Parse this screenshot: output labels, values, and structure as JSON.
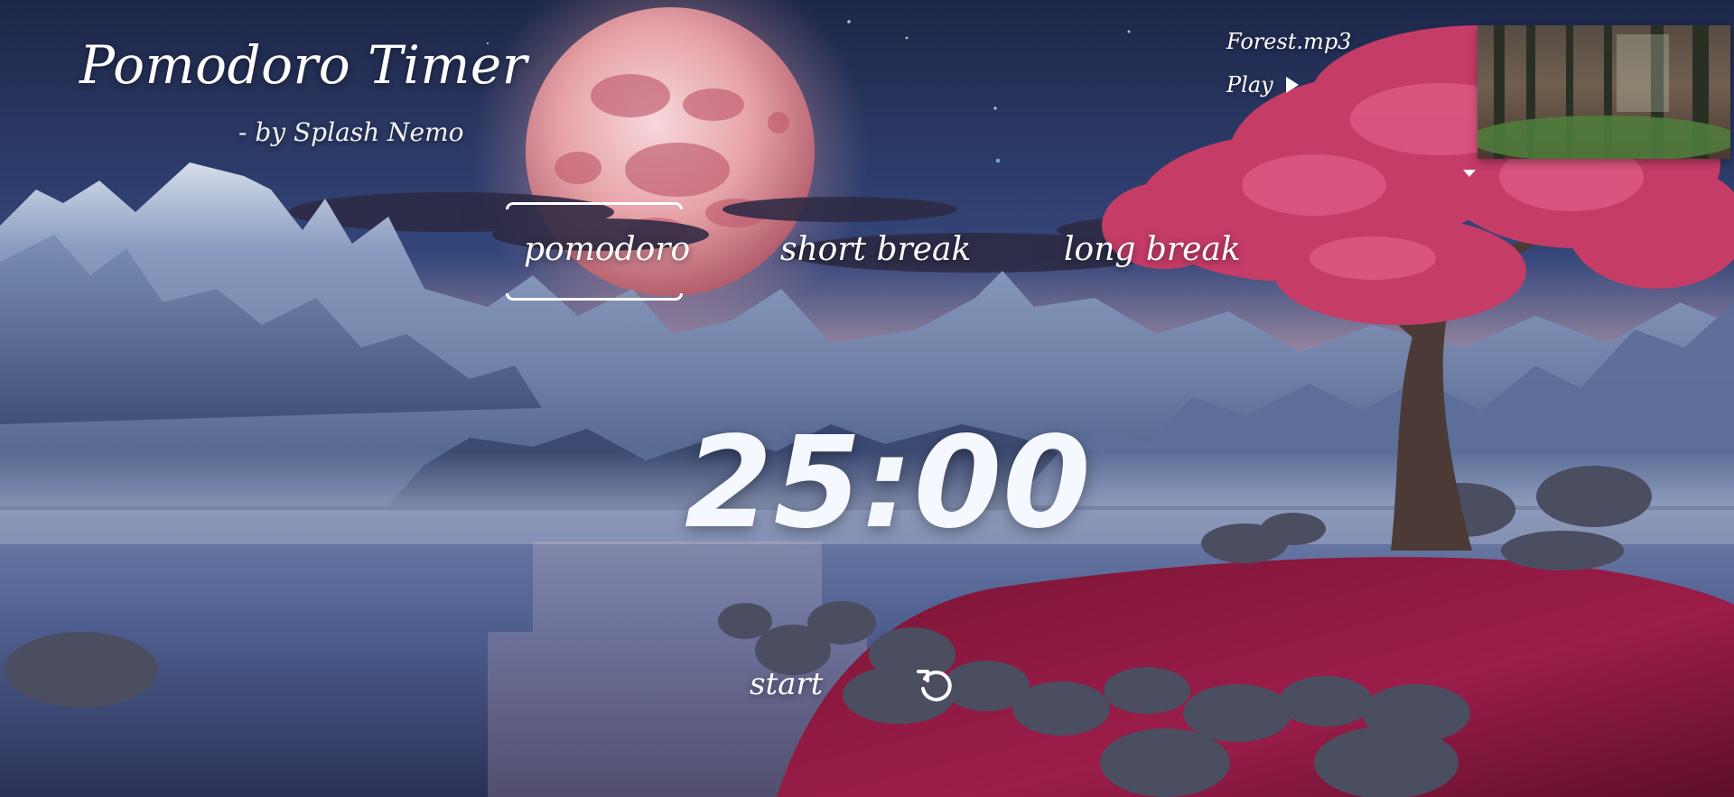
{
  "header": {
    "title": "Pomodoro Timer",
    "subtitle": "- by Splash Nemo"
  },
  "tabs": [
    {
      "label": "pomodoro",
      "active": true
    },
    {
      "label": "short break",
      "active": false
    },
    {
      "label": "long break",
      "active": false
    }
  ],
  "timer": {
    "display": "25:00"
  },
  "controls": {
    "start_label": "start",
    "reset_icon": "refresh-icon"
  },
  "music": {
    "track_name": "Forest.mp3",
    "play_label": "Play",
    "play_icon": "play-icon",
    "dropdown_icon": "caret-down-icon"
  },
  "colors": {
    "text": "#ffffff",
    "moon": "#e6a3a8",
    "tree": "#c53c67",
    "meadow": "#9b1d49"
  }
}
